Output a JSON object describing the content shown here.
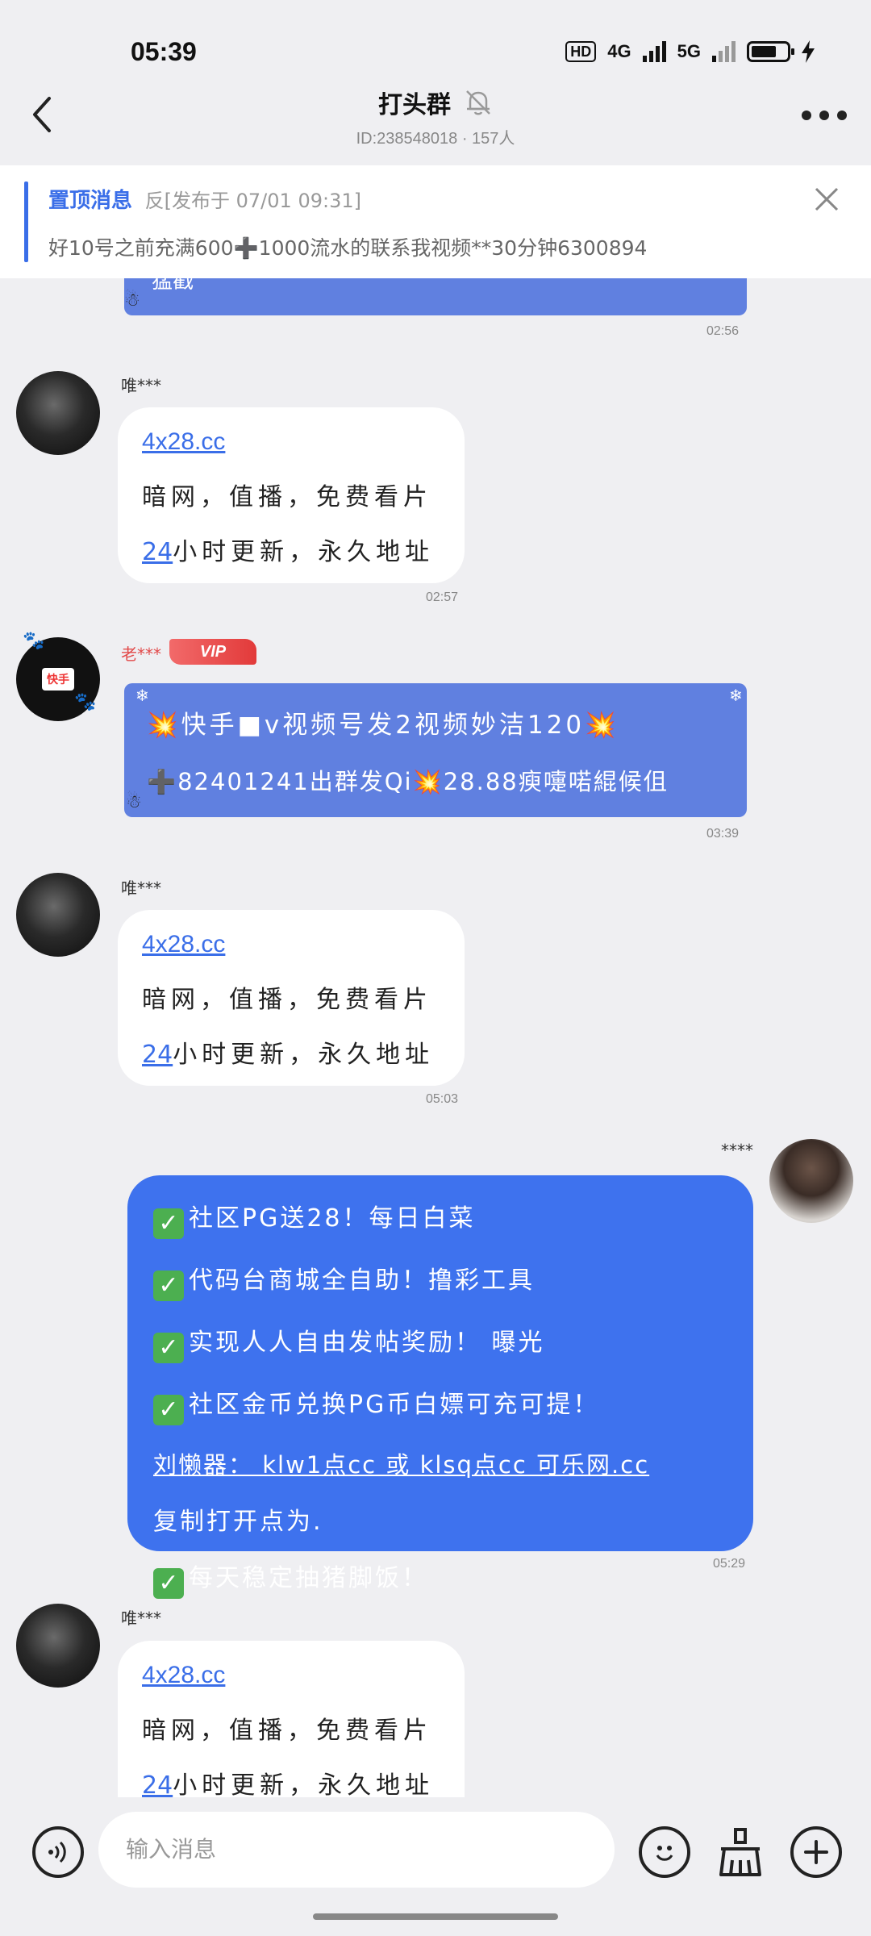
{
  "status_bar": {
    "time": "05:39",
    "hd": "HD",
    "net1": "4G",
    "net2": "5G"
  },
  "header": {
    "title": "打头群",
    "subtitle": "ID:238548018 · 157人"
  },
  "pinned": {
    "label": "置顶消息",
    "meta": "反[发布于 07/01 09:31]",
    "text": "好10号之前充满600➕1000流水的联系我视频**30分钟6300894"
  },
  "messages": [
    {
      "type": "partial_blue",
      "preview": "猛戳",
      "time": "02:56"
    },
    {
      "type": "text",
      "sender": "唯***",
      "link": "4x28.cc",
      "line1": "暗网，值播，免费看片",
      "line2_num": "24",
      "line2": "小时更新，永久地址",
      "time": "02:57"
    },
    {
      "type": "promo",
      "sender": "老***",
      "vip": "VIP",
      "avatar_text": "快手",
      "line1": "💥快手■v视频号发2视频妙洁120💥",
      "line2": "➕82401241出群发Qi💥28.88瘐嚏喏緄候伹",
      "time": "03:39"
    },
    {
      "type": "text",
      "sender": "唯***",
      "link": "4x28.cc",
      "line1": "暗网，值播，免费看片",
      "line2_num": "24",
      "line2": "小时更新，永久地址",
      "time": "05:03"
    },
    {
      "type": "mine",
      "sender": "****",
      "lines": [
        "社区PG送28！每日白菜",
        "代码台商城全自助！撸彩工具",
        "实现人人自由发帖奖励！ 曝光",
        "社区金币兑换PG币白嫖可充可提！",
        "刘懒器： klw1点cc 或 klsq点cc 可乐网.cc",
        "复制打开点为.",
        "每天稳定抽猪脚饭！"
      ],
      "time": "05:29"
    },
    {
      "type": "text",
      "sender": "唯***",
      "link": "4x28.cc",
      "line1": "暗网，值播，免费看片",
      "line2_num": "24",
      "line2": "小时更新，永久地址",
      "time": ""
    }
  ],
  "input": {
    "placeholder": "输入消息"
  },
  "colors": {
    "accent": "#3a6ee8",
    "promo_bubble": "#6080e0",
    "my_bubble": "#3e72ee",
    "check": "#4caf50"
  }
}
